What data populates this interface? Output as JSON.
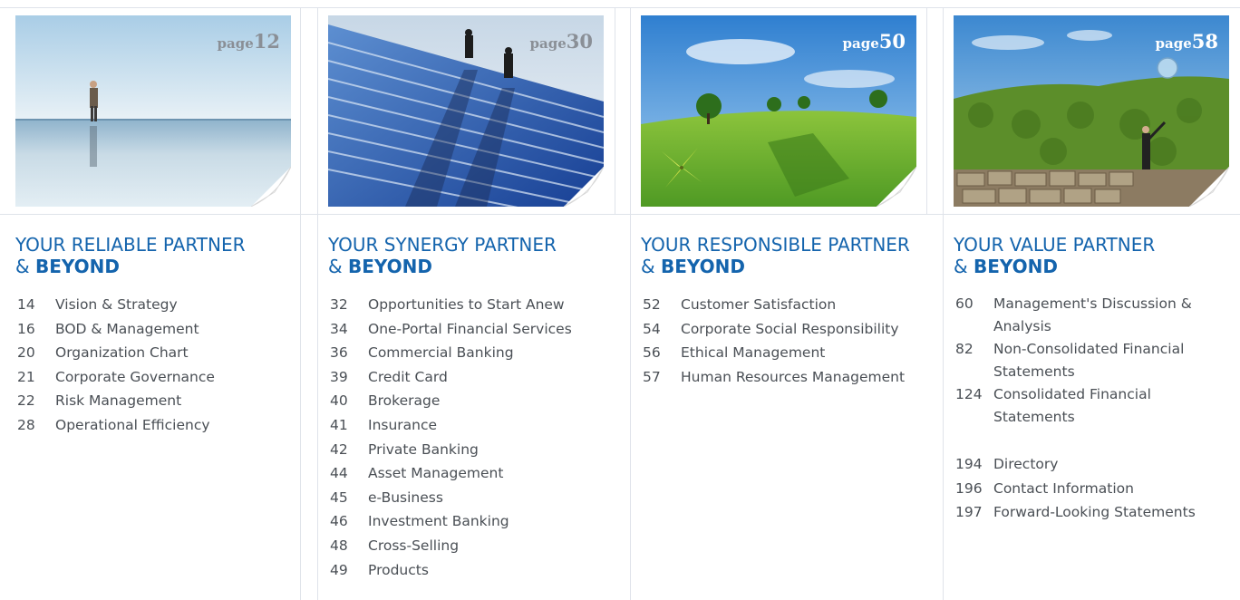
{
  "columns": [
    {
      "page_prefix": "page",
      "page_number": "12",
      "heading_line1": "YOUR RELIABLE PARTNER",
      "heading_amp": "&",
      "heading_bold": "BEYOND",
      "items": [
        {
          "page": "14",
          "title": "Vision & Strategy"
        },
        {
          "page": "16",
          "title": "BOD & Management"
        },
        {
          "page": "20",
          "title": "Organization Chart"
        },
        {
          "page": "21",
          "title": "Corporate Governance"
        },
        {
          "page": "22",
          "title": "Risk Management"
        },
        {
          "page": "28",
          "title": "Operational Efficiency"
        }
      ]
    },
    {
      "page_prefix": "page",
      "page_number": "30",
      "heading_line1": "YOUR SYNERGY PARTNER",
      "heading_amp": "&",
      "heading_bold": "BEYOND",
      "items": [
        {
          "page": "32",
          "title": "Opportunities to Start Anew"
        },
        {
          "page": "34",
          "title": "One-Portal Financial Services"
        },
        {
          "page": "36",
          "title": "Commercial Banking"
        },
        {
          "page": "39",
          "title": "Credit Card"
        },
        {
          "page": "40",
          "title": "Brokerage"
        },
        {
          "page": "41",
          "title": "Insurance"
        },
        {
          "page": "42",
          "title": "Private Banking"
        },
        {
          "page": "44",
          "title": "Asset Management"
        },
        {
          "page": "45",
          "title": "e-Business"
        },
        {
          "page": "46",
          "title": "Investment Banking"
        },
        {
          "page": "48",
          "title": "Cross-Selling"
        },
        {
          "page": "49",
          "title": "Products"
        }
      ]
    },
    {
      "page_prefix": "page",
      "page_number": "50",
      "heading_line1": "YOUR RESPONSIBLE PARTNER",
      "heading_amp": "&",
      "heading_bold": "BEYOND",
      "items": [
        {
          "page": "52",
          "title": "Customer Satisfaction"
        },
        {
          "page": "54",
          "title": "Corporate Social Responsibility"
        },
        {
          "page": "56",
          "title": "Ethical Management"
        },
        {
          "page": "57",
          "title": "Human Resources Management"
        }
      ]
    },
    {
      "page_prefix": "page",
      "page_number": "58",
      "heading_line1": "YOUR VALUE PARTNER",
      "heading_amp": "&",
      "heading_bold": "BEYOND",
      "items": [
        {
          "page": "60",
          "title": "Management's Discussion & Analysis"
        },
        {
          "page": "82",
          "title": "Non-Consolidated Financial Statements"
        },
        {
          "page": "124",
          "title": "Consolidated Financial Statements"
        },
        {
          "page": "194",
          "title": "Directory"
        },
        {
          "page": "196",
          "title": "Contact Information"
        },
        {
          "page": "197",
          "title": "Forward-Looking Statements"
        }
      ]
    }
  ],
  "colors": {
    "heading_blue": "#1464ad",
    "body_text": "#4a4f55",
    "grid_line": "#dfe3ea"
  }
}
